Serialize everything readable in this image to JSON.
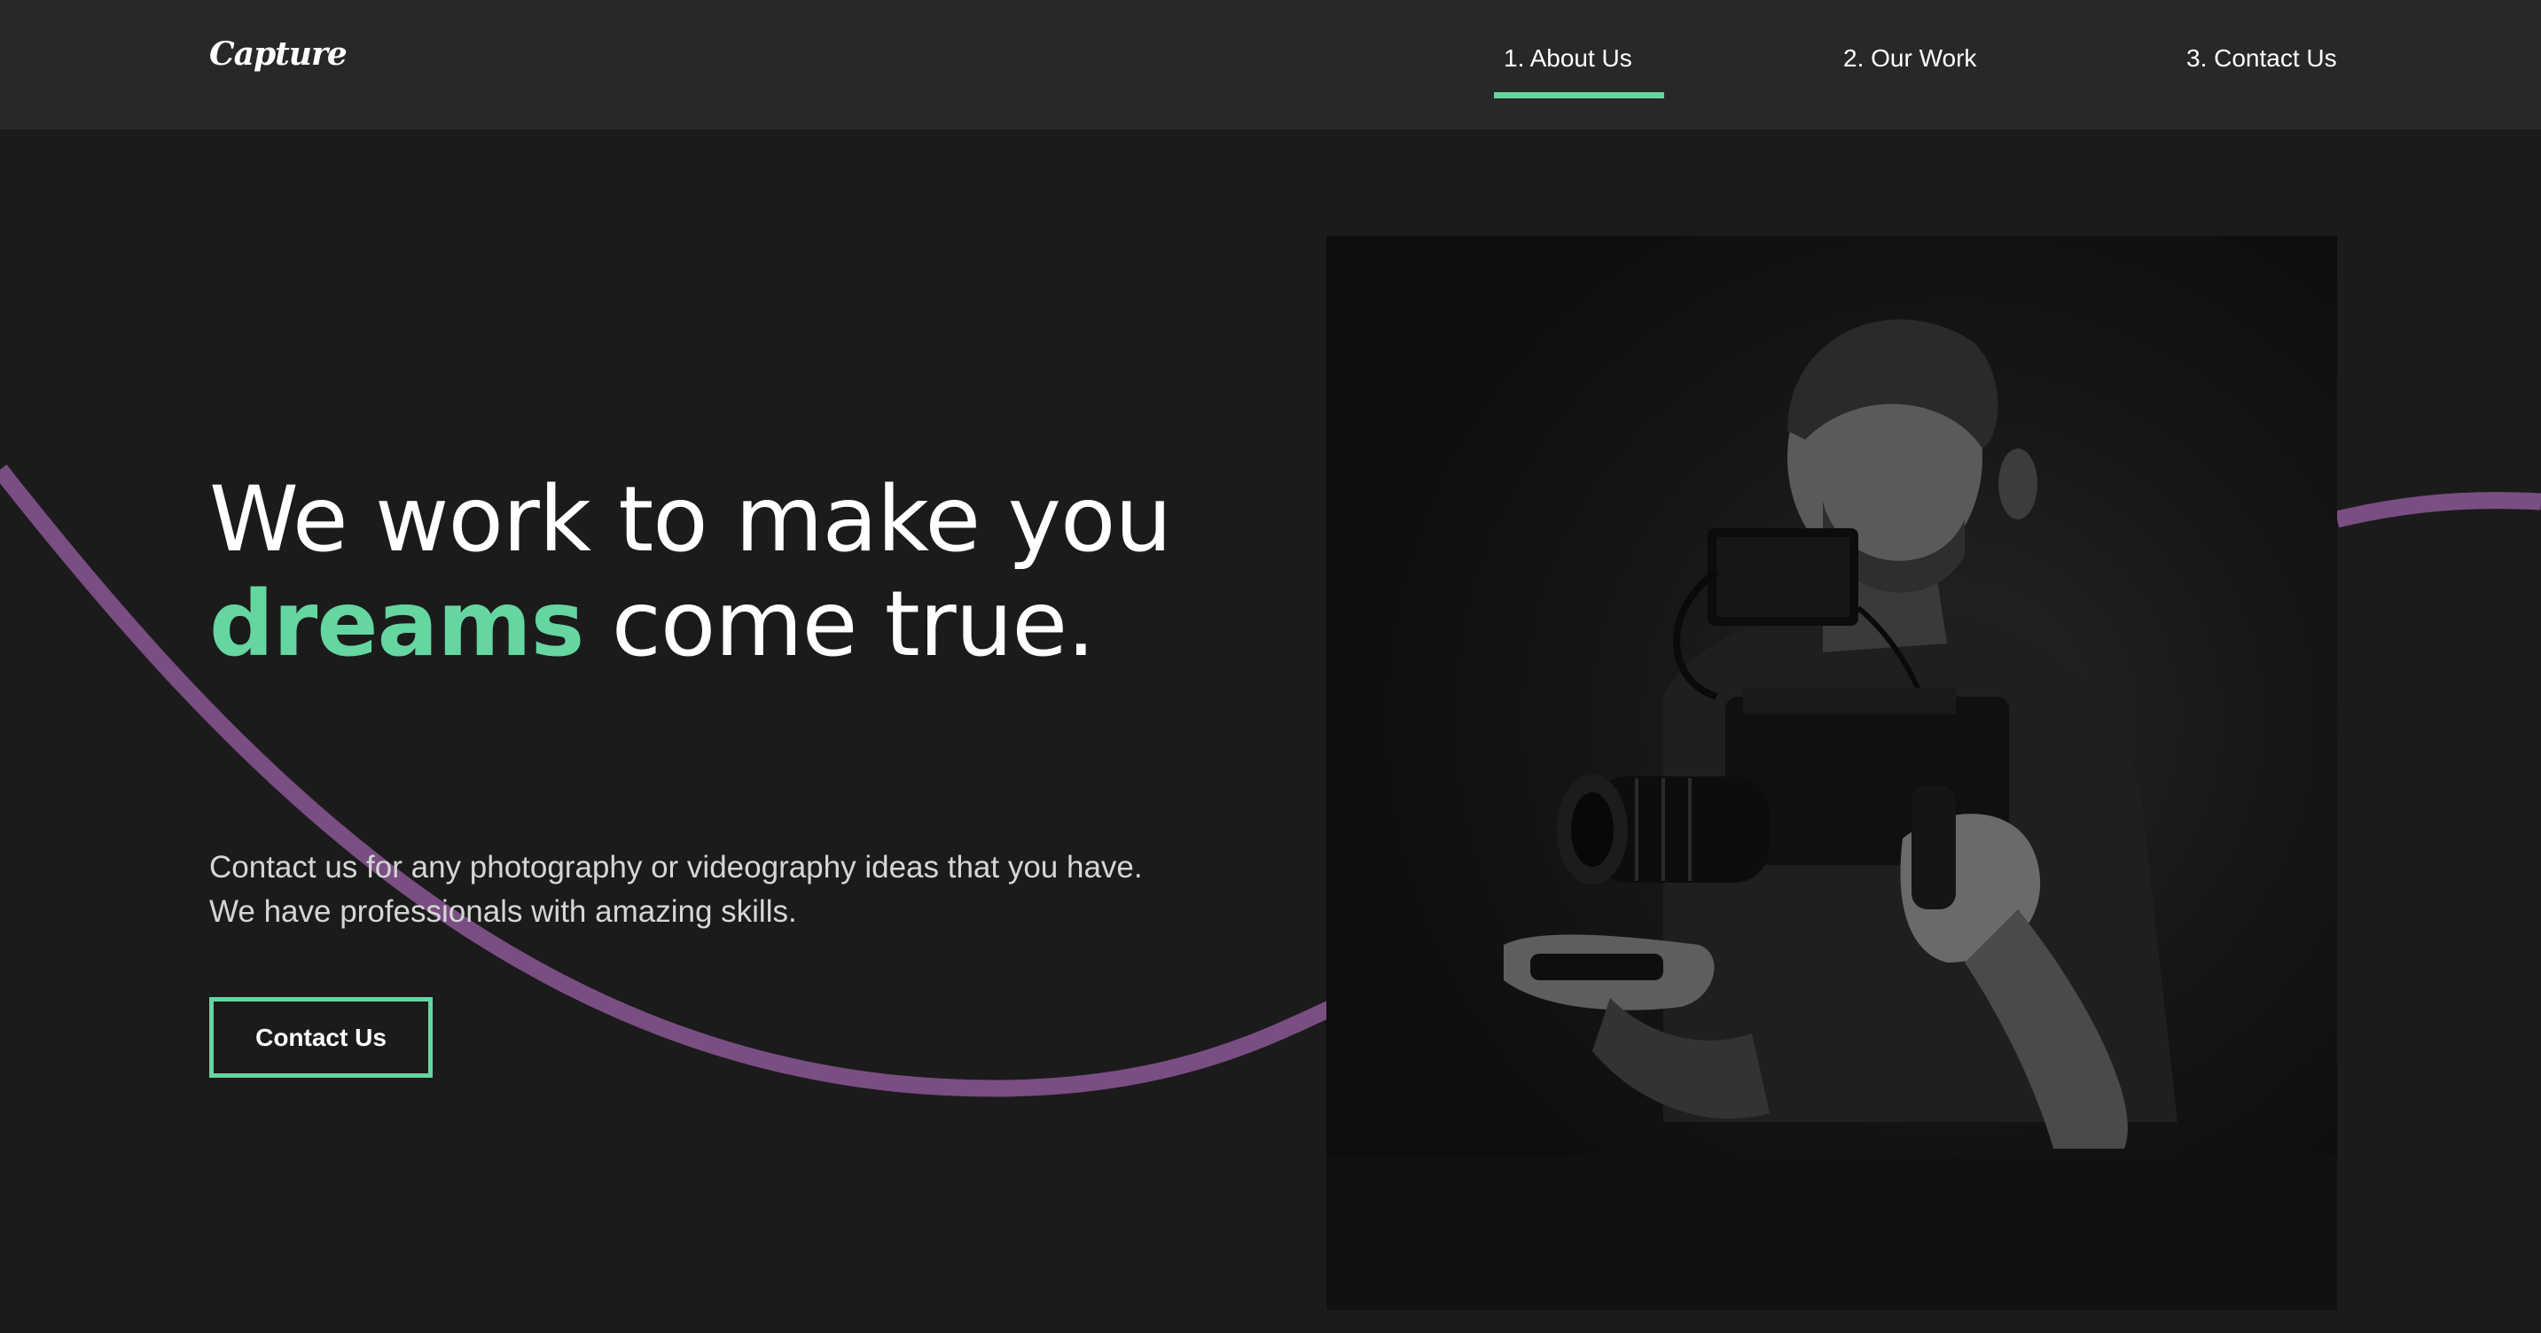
{
  "header": {
    "logo": "Capture",
    "nav": [
      {
        "label": "1. About Us",
        "active": true
      },
      {
        "label": "2. Our Work",
        "active": false
      },
      {
        "label": "3. Contact Us",
        "active": false
      }
    ]
  },
  "hero": {
    "headline_before": "We work to make you ",
    "headline_accent": "dreams",
    "headline_after": " come true.",
    "subtext_line1": "Contact us for any photography or videography ideas that you have.",
    "subtext_line2": "We have professionals with amazing skills.",
    "cta_label": "Contact Us"
  },
  "image": {
    "subject": "black-and-white photo of a videographer holding a camera rig"
  },
  "colors": {
    "background": "#1b1b1b",
    "header": "#282828",
    "accent": "#65d6a0",
    "wave": "#7a4e82",
    "text": "#ffffff"
  }
}
